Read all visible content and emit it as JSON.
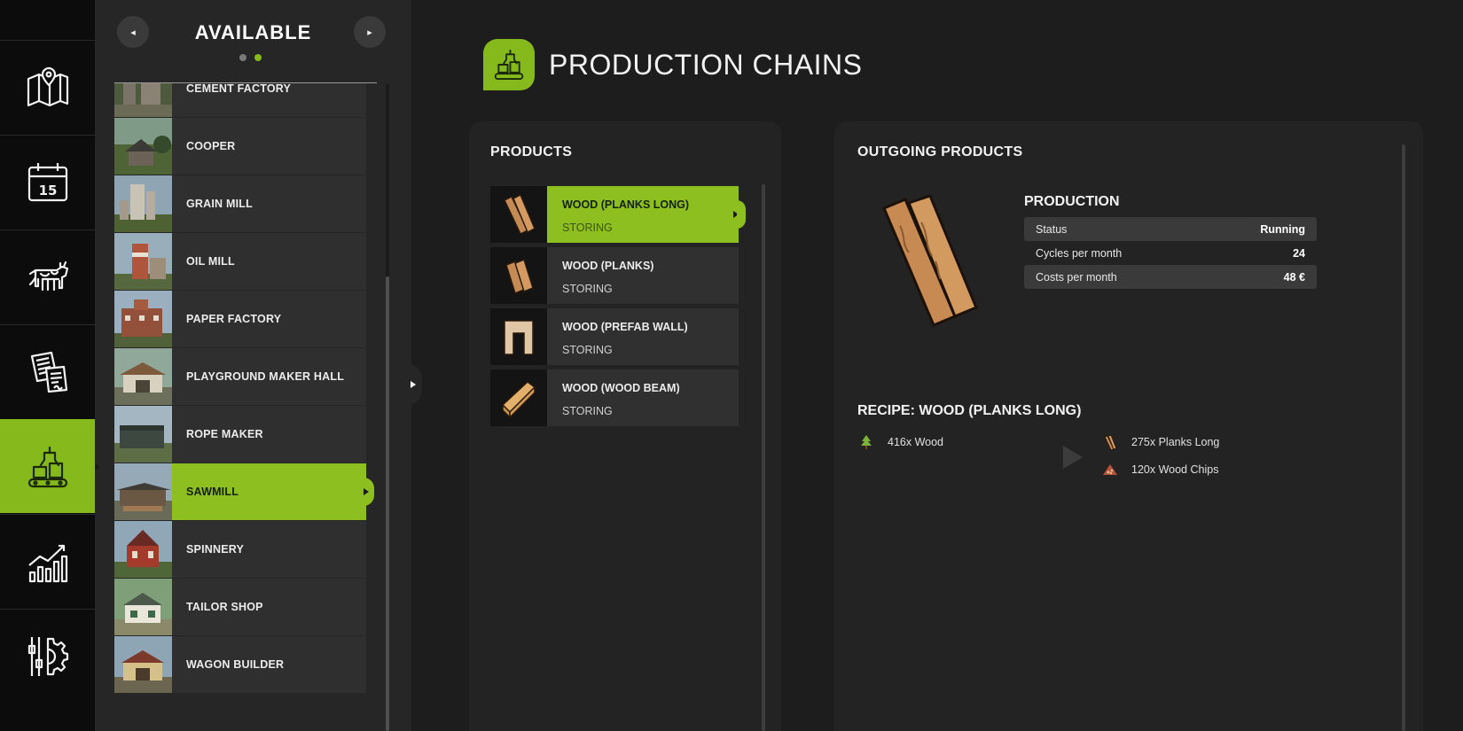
{
  "sidebar": {
    "items": [
      {
        "icon": "map-icon"
      },
      {
        "icon": "calendar-icon",
        "day": "15"
      },
      {
        "icon": "cow-icon"
      },
      {
        "icon": "contracts-icon"
      },
      {
        "icon": "production-icon",
        "active": true
      },
      {
        "icon": "statistics-icon"
      },
      {
        "icon": "settings-icon"
      }
    ]
  },
  "list": {
    "title": "AVAILABLE",
    "prev_symbol": "◂",
    "next_symbol": "▸",
    "productions": [
      {
        "label": "CEMENT FACTORY"
      },
      {
        "label": "COOPER"
      },
      {
        "label": "GRAIN MILL"
      },
      {
        "label": "OIL MILL"
      },
      {
        "label": "PAPER FACTORY"
      },
      {
        "label": "PLAYGROUND MAKER HALL"
      },
      {
        "label": "ROPE MAKER"
      },
      {
        "label": "SAWMILL",
        "selected": true
      },
      {
        "label": "SPINNERY"
      },
      {
        "label": "TAILOR SHOP"
      },
      {
        "label": "WAGON BUILDER"
      }
    ]
  },
  "page": {
    "title": "PRODUCTION CHAINS"
  },
  "products": {
    "title": "PRODUCTS",
    "items": [
      {
        "name": "WOOD (PLANKS LONG)",
        "status": "STORING",
        "selected": true
      },
      {
        "name": "WOOD (PLANKS)",
        "status": "STORING"
      },
      {
        "name": "WOOD (PREFAB WALL)",
        "status": "STORING"
      },
      {
        "name": "WOOD (WOOD BEAM)",
        "status": "STORING"
      }
    ]
  },
  "outgoing": {
    "title": "OUTGOING PRODUCTS",
    "production": {
      "title": "PRODUCTION",
      "rows": [
        {
          "key": "Status",
          "value": "Running"
        },
        {
          "key": "Cycles per month",
          "value": "24"
        },
        {
          "key": "Costs per month",
          "value": "48 €"
        }
      ]
    },
    "recipe": {
      "title": "RECIPE: WOOD (PLANKS LONG)",
      "inputs": [
        {
          "amount": "416x Wood",
          "icon": "tree-icon"
        }
      ],
      "outputs": [
        {
          "amount": "275x Planks Long",
          "icon": "planks-icon"
        },
        {
          "amount": "120x Wood Chips",
          "icon": "woodchips-icon"
        }
      ]
    }
  },
  "colors": {
    "accent": "#86ba1c",
    "background": "#1d1d1d",
    "panel": "#232323"
  }
}
